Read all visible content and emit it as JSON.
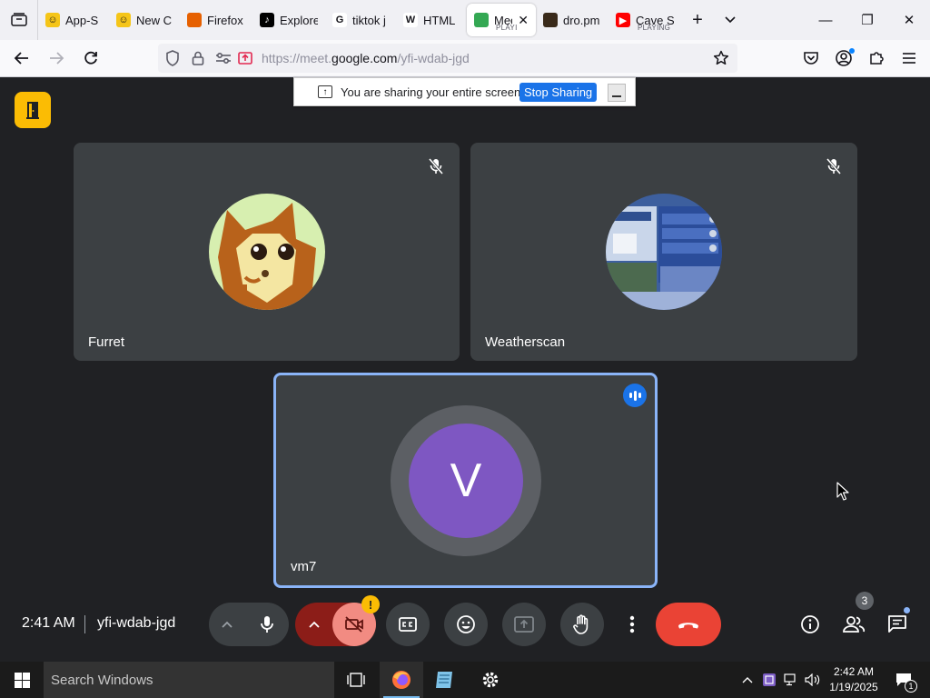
{
  "browser": {
    "tabs": [
      {
        "label": "App-S",
        "favicon_color": "#f5c518",
        "favicon_glyph": "☺"
      },
      {
        "label": "New C",
        "favicon_color": "#f5c518",
        "favicon_glyph": "☺"
      },
      {
        "label": "Firefox",
        "favicon_color": "#e66000",
        "favicon_glyph": ""
      },
      {
        "label": "Explore",
        "favicon_color": "#000000",
        "favicon_glyph": "♪"
      },
      {
        "label": "tiktok j",
        "favicon_color": "#ffffff",
        "favicon_glyph": "G"
      },
      {
        "label": "HTML",
        "favicon_color": "#ffffff",
        "favicon_glyph": "W"
      }
    ],
    "active_tab": {
      "label": "Mee",
      "sub": "PLAYI"
    },
    "tabs_after": [
      {
        "label": "dro.pm",
        "favicon_color": "#3a2a1a",
        "favicon_glyph": ""
      },
      {
        "label": "Cave S",
        "sub": "PLAYING",
        "favicon_color": "#ff0000",
        "favicon_glyph": "▶"
      }
    ],
    "url_host_prefix": "https://meet.",
    "url_host": "google.com",
    "url_path": "/yfi-wdab-jgd"
  },
  "share_banner": {
    "message": "You are sharing your entire screen.",
    "stop_label": "Stop Sharing"
  },
  "participants": [
    {
      "name": "Furret",
      "muted": true
    },
    {
      "name": "Weatherscan",
      "muted": true
    },
    {
      "name": "vm7",
      "initial": "V",
      "speaking": true,
      "avatar_color": "#7e57c2"
    }
  ],
  "controls": {
    "time": "2:41 AM",
    "meeting_code": "yfi-wdab-jgd",
    "people_count": "3",
    "warning_glyph": "!"
  },
  "taskbar": {
    "search_placeholder": "Search Windows",
    "time": "2:42 AM",
    "date": "1/19/2025",
    "notification_count": "1"
  }
}
